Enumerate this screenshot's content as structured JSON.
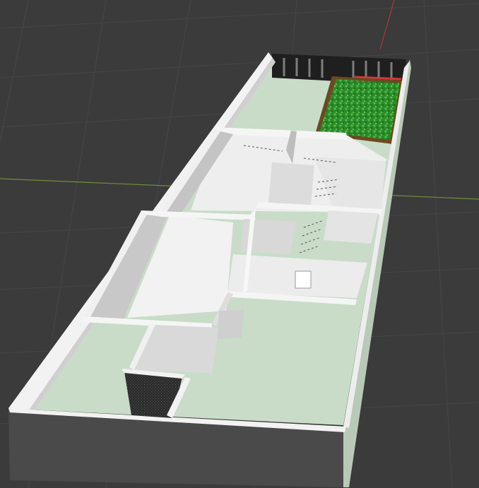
{
  "viewport": {
    "background_color": "#3b3b3b",
    "grid_color": "#454545",
    "axis_x_color": "#6f8f3a",
    "axis_y_color": "#a83a3a"
  },
  "model": {
    "floor_color": "#c9dcc8",
    "room_floor_color": "#eeeeee",
    "wall_top_color": "#f3f3f3",
    "wall_side_color": "#d0d0d0",
    "wall_shadow_color": "#8d8d8d",
    "outer_wall_dark": "#4a4a4a",
    "grass_color": "#2e8f2e",
    "planter_color": "#6b4a22",
    "fence_color": "#2a2a2a",
    "accent_red": "#d23a3a"
  }
}
